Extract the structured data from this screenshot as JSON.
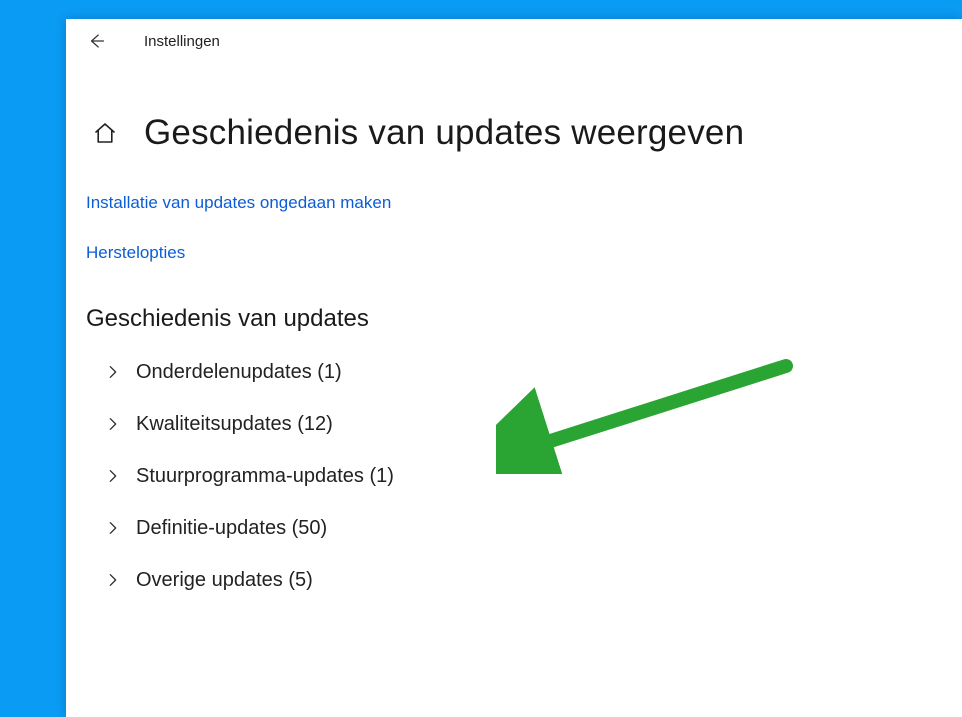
{
  "app": {
    "name": "Instellingen"
  },
  "page": {
    "title": "Geschiedenis van updates weergeven",
    "links": {
      "uninstall": "Installatie van updates ongedaan maken",
      "recovery": "Herstelopties"
    },
    "section_title": "Geschiedenis van updates",
    "expanders": [
      {
        "label": "Onderdelenupdates (1)"
      },
      {
        "label": "Kwaliteitsupdates (12)"
      },
      {
        "label": "Stuurprogramma-updates (1)"
      },
      {
        "label": "Definitie-updates (50)"
      },
      {
        "label": "Overige updates (5)"
      }
    ]
  }
}
